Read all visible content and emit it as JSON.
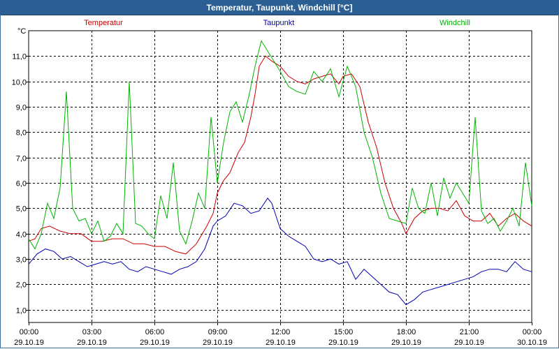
{
  "header": {
    "title": "Temperatur, Taupunkt, Windchill [°C]"
  },
  "chart_data": {
    "type": "line",
    "title": "Temperatur, Taupunkt, Windchill [°C]",
    "ylabel": "°C",
    "xlabel": "",
    "ylim": [
      0.5,
      12.0
    ],
    "xlim": [
      0,
      24
    ],
    "grid": true,
    "legend": "top",
    "yticks": [
      1.0,
      2.0,
      3.0,
      4.0,
      5.0,
      6.0,
      7.0,
      8.0,
      9.0,
      10.0,
      11.0
    ],
    "ytick_labels": [
      "1,0",
      "2,0",
      "3,0",
      "4,0",
      "5,0",
      "6,0",
      "7,0",
      "8,0",
      "9,0",
      "10,0",
      "11,0"
    ],
    "xticks": [
      {
        "time": "00:00",
        "date": "29.10.19"
      },
      {
        "time": "03:00",
        "date": "29.10.19"
      },
      {
        "time": "06:00",
        "date": "29.10.19"
      },
      {
        "time": "09:00",
        "date": "29.10.19"
      },
      {
        "time": "12:00",
        "date": "29.10.19"
      },
      {
        "time": "15:00",
        "date": "29.10.19"
      },
      {
        "time": "18:00",
        "date": "29.10.19"
      },
      {
        "time": "21:00",
        "date": "29.10.19"
      },
      {
        "time": "00:00",
        "date": "30.10.19"
      }
    ],
    "series": [
      {
        "name": "Temperatur",
        "color": "#cc0000",
        "x": [
          0,
          0.3,
          0.6,
          1.0,
          1.5,
          2.0,
          2.5,
          3.0,
          3.5,
          4.0,
          4.5,
          5.0,
          5.5,
          6.0,
          6.5,
          7.0,
          7.5,
          8.0,
          8.5,
          8.8,
          9.0,
          9.3,
          9.6,
          10.0,
          10.3,
          10.6,
          10.8,
          11.0,
          11.3,
          11.6,
          12.0,
          12.4,
          12.8,
          13.2,
          13.6,
          14.0,
          14.4,
          14.8,
          15.0,
          15.4,
          15.8,
          16.2,
          16.6,
          17.0,
          17.4,
          17.8,
          18.0,
          18.4,
          18.8,
          19.2,
          19.6,
          20.0,
          20.4,
          20.8,
          21.2,
          21.6,
          22.0,
          22.4,
          22.8,
          23.2,
          23.6,
          24.0
        ],
        "values": [
          3.7,
          3.8,
          4.2,
          4.3,
          4.1,
          4.0,
          4.0,
          3.7,
          3.7,
          3.8,
          3.8,
          3.6,
          3.6,
          3.5,
          3.5,
          3.3,
          3.2,
          3.6,
          4.3,
          4.8,
          5.6,
          6.1,
          6.4,
          7.2,
          7.6,
          8.6,
          9.5,
          10.6,
          11.0,
          10.8,
          10.6,
          10.2,
          10.0,
          9.9,
          10.1,
          10.2,
          10.3,
          9.9,
          10.2,
          10.3,
          9.8,
          8.4,
          7.4,
          6.0,
          5.0,
          4.4,
          4.0,
          4.6,
          4.9,
          5.0,
          5.0,
          4.9,
          5.3,
          4.7,
          4.5,
          4.5,
          4.8,
          4.3,
          4.6,
          4.8,
          4.5,
          4.3
        ]
      },
      {
        "name": "Taupunkt",
        "color": "#0000b4",
        "x": [
          0,
          0.4,
          0.8,
          1.2,
          1.6,
          2.0,
          2.4,
          2.8,
          3.2,
          3.6,
          4.0,
          4.4,
          4.8,
          5.2,
          5.6,
          6.0,
          6.4,
          6.8,
          7.2,
          7.6,
          8.0,
          8.4,
          8.8,
          9.0,
          9.4,
          9.8,
          10.2,
          10.6,
          11.0,
          11.4,
          11.6,
          12.0,
          12.4,
          12.8,
          13.2,
          13.6,
          14.0,
          14.4,
          14.8,
          15.2,
          15.6,
          16.0,
          16.4,
          16.8,
          17.2,
          17.6,
          18.0,
          18.4,
          18.8,
          19.2,
          19.6,
          20.0,
          20.4,
          20.8,
          21.2,
          21.6,
          22.0,
          22.4,
          22.8,
          23.2,
          23.6,
          24.0
        ],
        "values": [
          2.8,
          3.2,
          3.4,
          3.3,
          3.0,
          3.1,
          2.9,
          2.7,
          2.8,
          2.9,
          2.8,
          2.9,
          2.6,
          2.5,
          2.7,
          2.6,
          2.5,
          2.4,
          2.6,
          2.7,
          2.9,
          3.4,
          4.3,
          4.5,
          4.7,
          5.2,
          5.1,
          4.8,
          4.9,
          5.4,
          5.2,
          4.2,
          3.9,
          3.7,
          3.5,
          3.0,
          2.9,
          3.0,
          2.8,
          2.9,
          2.2,
          2.6,
          2.3,
          2.0,
          1.7,
          1.6,
          1.2,
          1.4,
          1.7,
          1.8,
          1.9,
          2.0,
          2.1,
          2.2,
          2.3,
          2.5,
          2.6,
          2.6,
          2.5,
          2.9,
          2.6,
          2.5
        ]
      },
      {
        "name": "Windchill",
        "color": "#00b400",
        "x": [
          0,
          0.3,
          0.6,
          0.9,
          1.2,
          1.5,
          1.8,
          2.1,
          2.4,
          2.7,
          3.0,
          3.3,
          3.6,
          3.9,
          4.2,
          4.5,
          4.8,
          5.1,
          5.4,
          5.7,
          6.0,
          6.3,
          6.6,
          6.9,
          7.2,
          7.5,
          7.8,
          8.1,
          8.4,
          8.7,
          9.0,
          9.3,
          9.6,
          9.9,
          10.2,
          10.5,
          10.8,
          11.1,
          11.4,
          11.7,
          12.0,
          12.4,
          12.8,
          13.2,
          13.6,
          14.0,
          14.4,
          14.8,
          15.2,
          15.6,
          16.0,
          16.4,
          16.8,
          17.2,
          17.6,
          18.0,
          18.3,
          18.6,
          18.9,
          19.2,
          19.5,
          19.8,
          20.1,
          20.4,
          20.7,
          21.0,
          21.3,
          21.6,
          21.9,
          22.2,
          22.5,
          22.8,
          23.1,
          23.4,
          23.7,
          24.0
        ],
        "values": [
          3.8,
          3.4,
          4.0,
          5.2,
          4.6,
          5.8,
          9.6,
          5.0,
          4.5,
          4.6,
          4.0,
          4.5,
          3.7,
          3.9,
          4.4,
          4.0,
          10.0,
          4.4,
          4.3,
          4.0,
          3.8,
          5.5,
          4.6,
          6.8,
          4.1,
          3.6,
          4.5,
          5.6,
          5.0,
          8.6,
          6.0,
          7.6,
          8.8,
          9.2,
          8.4,
          9.4,
          10.6,
          11.6,
          11.2,
          10.8,
          10.4,
          9.8,
          9.6,
          9.5,
          10.4,
          10.0,
          10.5,
          9.4,
          10.6,
          9.8,
          8.0,
          7.0,
          5.6,
          4.6,
          4.5,
          4.4,
          5.8,
          5.0,
          4.8,
          6.0,
          4.7,
          6.2,
          5.4,
          6.0,
          5.6,
          5.2,
          8.6,
          4.9,
          4.4,
          4.6,
          4.1,
          4.5,
          5.0,
          4.3,
          6.8,
          5.1
        ]
      }
    ]
  }
}
